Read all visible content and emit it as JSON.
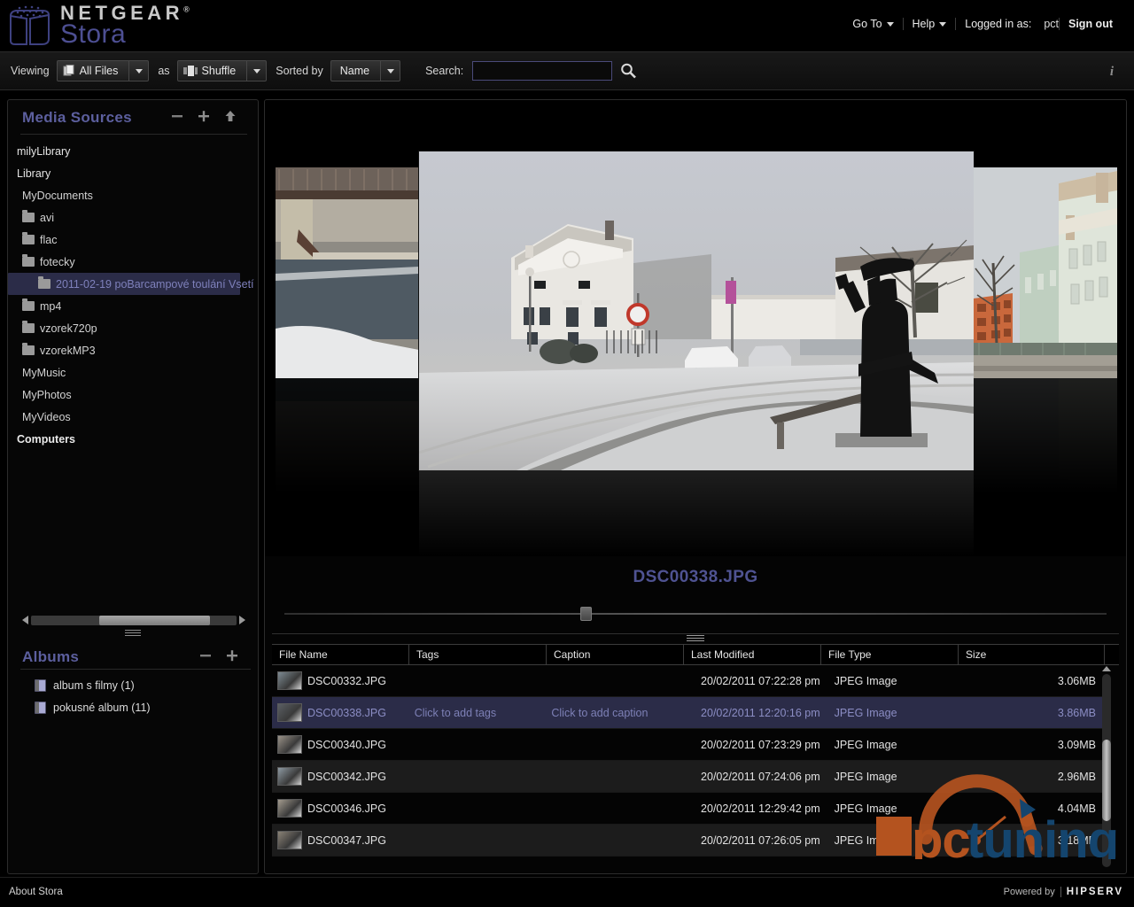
{
  "header": {
    "brand_primary": "NETGEAR",
    "brand_reg": "®",
    "brand_secondary": "Stora",
    "nav": {
      "goto": "Go To",
      "help": "Help",
      "logged_in_label": "Logged in as:",
      "user": "pct",
      "signout": "Sign out"
    }
  },
  "toolbar": {
    "viewing_label": "Viewing",
    "viewing_value": "All Files",
    "as_label": "as",
    "as_value": "Shuffle",
    "sorted_label": "Sorted by",
    "sorted_value": "Name",
    "search_label": "Search:",
    "search_value": "",
    "search_placeholder": "",
    "info_glyph": "i"
  },
  "sidebar": {
    "media_sources": {
      "title": "Media Sources",
      "buttons": {
        "remove": "−",
        "add": "+",
        "upload": "↑"
      },
      "tree": [
        {
          "label": "milyLibrary",
          "level": 0,
          "folder": false,
          "bold": false,
          "selected": false
        },
        {
          "label": "Library",
          "level": 0,
          "folder": false,
          "bold": false,
          "selected": false
        },
        {
          "label": "MyDocuments",
          "level": 1,
          "folder": false,
          "bold": false,
          "selected": false
        },
        {
          "label": "avi",
          "level": 1,
          "folder": true,
          "bold": false,
          "selected": false
        },
        {
          "label": "flac",
          "level": 1,
          "folder": true,
          "bold": false,
          "selected": false
        },
        {
          "label": "fotecky",
          "level": 1,
          "folder": true,
          "bold": false,
          "selected": false
        },
        {
          "label": "2011-02-19 poBarcampové toulání Vsetí",
          "level": 3,
          "folder": true,
          "bold": false,
          "selected": true
        },
        {
          "label": "mp4",
          "level": 1,
          "folder": true,
          "bold": false,
          "selected": false
        },
        {
          "label": "vzorek720p",
          "level": 1,
          "folder": true,
          "bold": false,
          "selected": false
        },
        {
          "label": "vzorekMP3",
          "level": 1,
          "folder": true,
          "bold": false,
          "selected": false
        },
        {
          "label": "MyMusic",
          "level": 1,
          "folder": false,
          "bold": false,
          "selected": false
        },
        {
          "label": "MyPhotos",
          "level": 1,
          "folder": false,
          "bold": false,
          "selected": false
        },
        {
          "label": "MyVideos",
          "level": 1,
          "folder": false,
          "bold": false,
          "selected": false
        },
        {
          "label": "Computers",
          "level": 0,
          "folder": false,
          "bold": true,
          "selected": false
        }
      ]
    },
    "albums": {
      "title": "Albums",
      "buttons": {
        "remove": "−",
        "add": "+"
      },
      "items": [
        {
          "label": "album s filmy (1)"
        },
        {
          "label": "pokusné album (11)"
        }
      ]
    }
  },
  "viewer": {
    "current_title": "DSC00338.JPG",
    "slider_position_pct": 36
  },
  "file_table": {
    "columns": [
      "File Name",
      "Tags",
      "Caption",
      "Last Modified",
      "File Type",
      "Size"
    ],
    "rows": [
      {
        "name": "DSC00332.JPG",
        "tags": "",
        "caption": "",
        "modified": "20/02/2011 07:22:28 pm",
        "type": "JPEG Image",
        "size": "3.06MB",
        "selected": false
      },
      {
        "name": "DSC00338.JPG",
        "tags": "Click to add tags",
        "caption": "Click to add caption",
        "modified": "20/02/2011 12:20:16 pm",
        "type": "JPEG Image",
        "size": "3.86MB",
        "selected": true
      },
      {
        "name": "DSC00340.JPG",
        "tags": "",
        "caption": "",
        "modified": "20/02/2011 07:23:29 pm",
        "type": "JPEG Image",
        "size": "3.09MB",
        "selected": false
      },
      {
        "name": "DSC00342.JPG",
        "tags": "",
        "caption": "",
        "modified": "20/02/2011 07:24:06 pm",
        "type": "JPEG Image",
        "size": "2.96MB",
        "selected": false
      },
      {
        "name": "DSC00346.JPG",
        "tags": "",
        "caption": "",
        "modified": "20/02/2011 12:29:42 pm",
        "type": "JPEG Image",
        "size": "4.04MB",
        "selected": false
      },
      {
        "name": "DSC00347.JPG",
        "tags": "",
        "caption": "",
        "modified": "20/02/2011 07:26:05 pm",
        "type": "JPEG Image",
        "size": "3.18MB",
        "selected": false
      }
    ]
  },
  "watermark": {
    "text_pc": "pc",
    "text_tuning": "tuning"
  },
  "footer": {
    "about": "About Stora",
    "powered_by": "Powered by",
    "hipserv": "HIPSERV"
  },
  "colors": {
    "accent_purple": "#5c5f9e",
    "selection": "#2b2c48",
    "watermark_orange": "#b4531f",
    "watermark_blue": "#14456e"
  }
}
